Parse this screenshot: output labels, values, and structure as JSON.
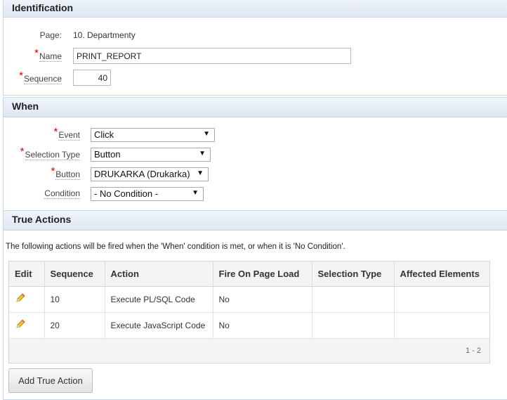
{
  "identification": {
    "title": "Identification",
    "page_label": "Page:",
    "page_value": "10. Departmenty",
    "name_label": "Name",
    "name_value": "PRINT_REPORT",
    "sequence_label": "Sequence",
    "sequence_value": "40"
  },
  "when": {
    "title": "When",
    "event_label": "Event",
    "event_value": "Click",
    "selection_type_label": "Selection Type",
    "selection_type_value": "Button",
    "button_label": "Button",
    "button_value": "DRUKARKA (Drukarka)",
    "condition_label": "Condition",
    "condition_value": "- No Condition -"
  },
  "true_actions": {
    "title": "True Actions",
    "description": "The following actions will be fired when the 'When' condition is met, or when it is 'No Condition'.",
    "columns": [
      "Edit",
      "Sequence",
      "Action",
      "Fire On Page Load",
      "Selection Type",
      "Affected Elements"
    ],
    "rows": [
      {
        "sequence": "10",
        "action": "Execute PL/SQL Code",
        "fire_on_page_load": "No",
        "selection_type": "",
        "affected_elements": ""
      },
      {
        "sequence": "20",
        "action": "Execute JavaScript Code",
        "fire_on_page_load": "No",
        "selection_type": "",
        "affected_elements": ""
      }
    ],
    "pagination": "1 - 2",
    "add_button": "Add True Action"
  },
  "required_marker": "*",
  "icons": {
    "edit": "pencil-icon",
    "dropdown": "triangle-down-icon"
  }
}
